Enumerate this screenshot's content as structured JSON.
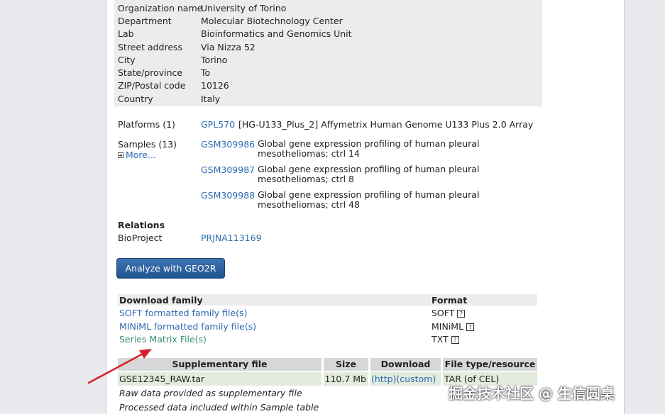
{
  "contact": [
    {
      "label": "Organization name",
      "value": "University of Torino"
    },
    {
      "label": "Department",
      "value": "Molecular Biotechnology Center"
    },
    {
      "label": "Lab",
      "value": "Bioinformatics and Genomics Unit"
    },
    {
      "label": "Street address",
      "value": "Via Nizza 52"
    },
    {
      "label": "City",
      "value": "Torino"
    },
    {
      "label": "State/province",
      "value": "To"
    },
    {
      "label": "ZIP/Postal code",
      "value": "10126"
    },
    {
      "label": "Country",
      "value": "Italy"
    }
  ],
  "platforms": {
    "label": "Platforms (1)",
    "id": "GPL570",
    "desc": "[HG-U133_Plus_2] Affymetrix Human Genome U133 Plus 2.0 Array"
  },
  "samples": {
    "label": "Samples (13)",
    "more": "More...",
    "items": [
      {
        "id": "GSM309986",
        "line1": "Global gene expression profiling of human pleural",
        "line2": "mesotheliomas; ctrl 14"
      },
      {
        "id": "GSM309987",
        "line1": "Global gene expression profiling of human pleural",
        "line2": "mesotheliomas; ctrl 8"
      },
      {
        "id": "GSM309988",
        "line1": "Global gene expression profiling of human pleural",
        "line2": "mesotheliomas; ctrl 48"
      }
    ]
  },
  "relations": {
    "heading": "Relations",
    "label": "BioProject",
    "value": "PRJNA113169"
  },
  "analyze_button": "Analyze with GEO2R",
  "download_family": {
    "col_name": "Download family",
    "col_format": "Format",
    "rows": [
      {
        "name": "SOFT formatted family file(s)",
        "format": "SOFT"
      },
      {
        "name": "MINiML formatted family file(s)",
        "format": "MINiML"
      },
      {
        "name": "Series Matrix File(s)",
        "format": "TXT"
      }
    ],
    "help_glyph": "?"
  },
  "supplementary": {
    "headers": [
      "Supplementary file",
      "Size",
      "Download",
      "File type/resource"
    ],
    "row": {
      "file": "GSE12345_RAW.tar",
      "size": "110.7 Mb",
      "http": "(http)",
      "custom": "(custom)",
      "type": "TAR (of CEL)"
    },
    "notes": [
      "Raw data provided as supplementary file",
      "Processed data included within Sample table"
    ]
  },
  "watermark": "掘金技术社区 @ 生信圆桌",
  "colors": {
    "link": "#2c6bb3",
    "visited": "#3a8f7a",
    "button": "#2a5f9e",
    "arrow": "#d4202a"
  }
}
